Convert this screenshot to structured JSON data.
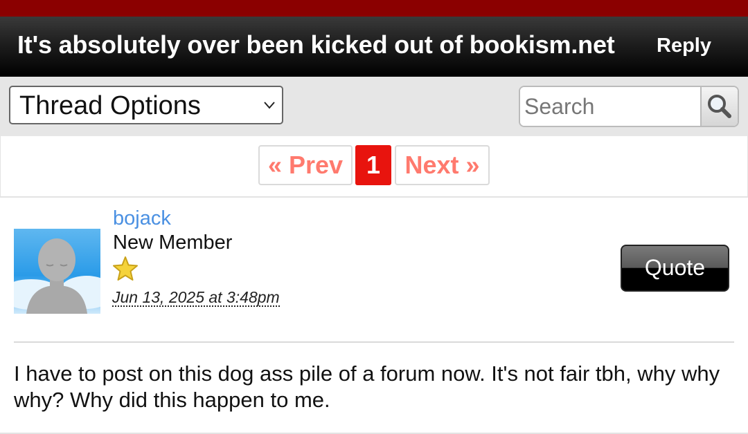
{
  "header": {
    "title": "It's absolutely over been kicked out of bookism.net",
    "reply_label": "Reply"
  },
  "toolbar": {
    "thread_options_label": "Thread Options",
    "search_placeholder": "Search"
  },
  "pagination": {
    "prev_label": "« Prev",
    "current_page": "1",
    "next_label": "Next »"
  },
  "post": {
    "username": "bojack",
    "rank": "New Member",
    "date": "Jun 13, 2025 at 3:48pm",
    "quote_label": "Quote",
    "body": "I have to post on this dog ass pile of a forum now. It's not fair tbh, why why why? Why did this happen to me."
  },
  "colors": {
    "top_strip": "#8b0000",
    "page_current": "#e8140e",
    "page_link": "#ff7a6e",
    "username": "#4a90e2"
  }
}
